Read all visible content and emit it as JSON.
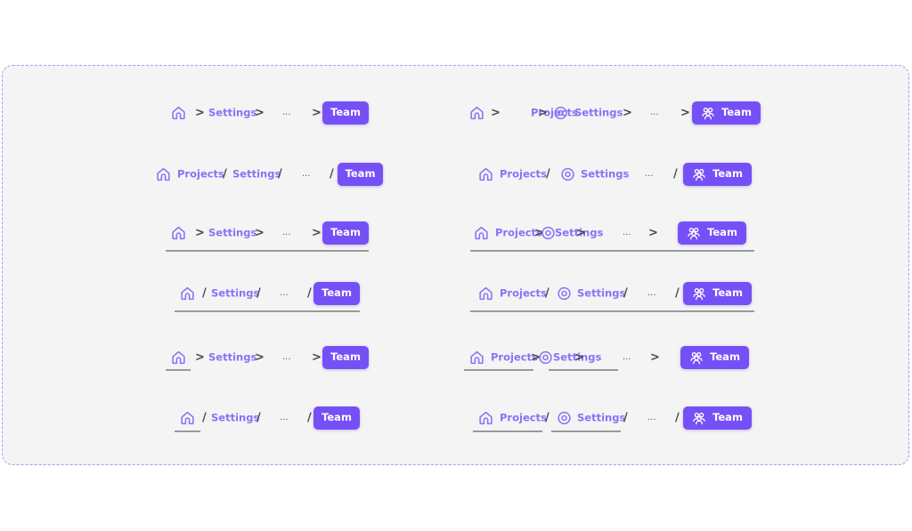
{
  "colors": {
    "accent": "#7650f7",
    "link": "#8a72f6",
    "separator": "#4a4a4a",
    "background": "#f4f4f4",
    "border": "#a99af0"
  },
  "breadcrumbs": [
    {
      "items": [
        {
          "icon": "home-icon"
        },
        {
          "sep": ">"
        },
        {
          "text": "Settings"
        },
        {
          "sep": ">"
        },
        {
          "text": "..."
        },
        {
          "sep": ">"
        },
        {
          "button": "Team"
        }
      ]
    },
    {
      "items": [
        {
          "icon": "home-icon"
        },
        {
          "sep": ">"
        },
        {
          "text": "Projects"
        },
        {
          "sep": ">"
        },
        {
          "icon": "gear-icon"
        },
        {
          "text": "Settings"
        },
        {
          "sep": ">"
        },
        {
          "text": "..."
        },
        {
          "sep": ">"
        },
        {
          "button": "Team",
          "icon": "users-icon"
        }
      ]
    },
    {
      "items": [
        {
          "icon": "home-icon"
        },
        {
          "text": "Projects"
        },
        {
          "sep": "/"
        },
        {
          "text": "Settings"
        },
        {
          "sep": "/"
        },
        {
          "text": "..."
        },
        {
          "sep": "/"
        },
        {
          "button": "Team"
        }
      ]
    },
    {
      "items": [
        {
          "icon": "home-icon"
        },
        {
          "text": "Projects"
        },
        {
          "sep": "/"
        },
        {
          "icon": "gear-icon"
        },
        {
          "text": "Settings"
        },
        {
          "text": "..."
        },
        {
          "sep": "/"
        },
        {
          "button": "Team",
          "icon": "users-icon"
        }
      ]
    },
    {
      "items": [
        {
          "icon": "home-icon"
        },
        {
          "sep": ">"
        },
        {
          "text": "Settings"
        },
        {
          "sep": ">"
        },
        {
          "text": "..."
        },
        {
          "sep": ">"
        },
        {
          "button": "Team"
        }
      ]
    },
    {
      "items": [
        {
          "icon": "home-icon"
        },
        {
          "text": "Projects"
        },
        {
          "sep": ">"
        },
        {
          "icon": "gear-icon"
        },
        {
          "text": "Settings"
        },
        {
          "sep": ">"
        },
        {
          "text": "..."
        },
        {
          "sep": ">"
        },
        {
          "button": "Team",
          "icon": "users-icon"
        }
      ]
    },
    {
      "items": [
        {
          "icon": "home-icon"
        },
        {
          "sep": "/"
        },
        {
          "text": "Settings"
        },
        {
          "sep": "/"
        },
        {
          "text": "..."
        },
        {
          "sep": "/"
        },
        {
          "button": "Team"
        }
      ]
    },
    {
      "items": [
        {
          "icon": "home-icon"
        },
        {
          "text": "Projects"
        },
        {
          "sep": "/"
        },
        {
          "icon": "gear-icon"
        },
        {
          "text": "Settings"
        },
        {
          "sep": "/"
        },
        {
          "text": "..."
        },
        {
          "sep": "/"
        },
        {
          "button": "Team",
          "icon": "users-icon"
        }
      ]
    },
    {
      "items": [
        {
          "icon": "home-icon"
        },
        {
          "sep": ">"
        },
        {
          "text": "Settings"
        },
        {
          "sep": ">"
        },
        {
          "text": "..."
        },
        {
          "sep": ">"
        },
        {
          "button": "Team"
        }
      ]
    },
    {
      "items": [
        {
          "icon": "home-icon"
        },
        {
          "text": "Projects"
        },
        {
          "sep": ">"
        },
        {
          "icon": "gear-icon"
        },
        {
          "text": "Settings"
        },
        {
          "sep": ">"
        },
        {
          "text": "..."
        },
        {
          "sep": ">"
        },
        {
          "button": "Team",
          "icon": "users-icon"
        }
      ]
    },
    {
      "items": [
        {
          "icon": "home-icon"
        },
        {
          "sep": "/"
        },
        {
          "text": "Settings"
        },
        {
          "sep": "/"
        },
        {
          "text": "..."
        },
        {
          "sep": "/"
        },
        {
          "button": "Team"
        }
      ]
    },
    {
      "items": [
        {
          "icon": "home-icon"
        },
        {
          "text": "Projects"
        },
        {
          "sep": "/"
        },
        {
          "icon": "gear-icon"
        },
        {
          "text": "Settings"
        },
        {
          "sep": "/"
        },
        {
          "text": "..."
        },
        {
          "sep": "/"
        },
        {
          "button": "Team",
          "icon": "users-icon"
        }
      ]
    }
  ]
}
